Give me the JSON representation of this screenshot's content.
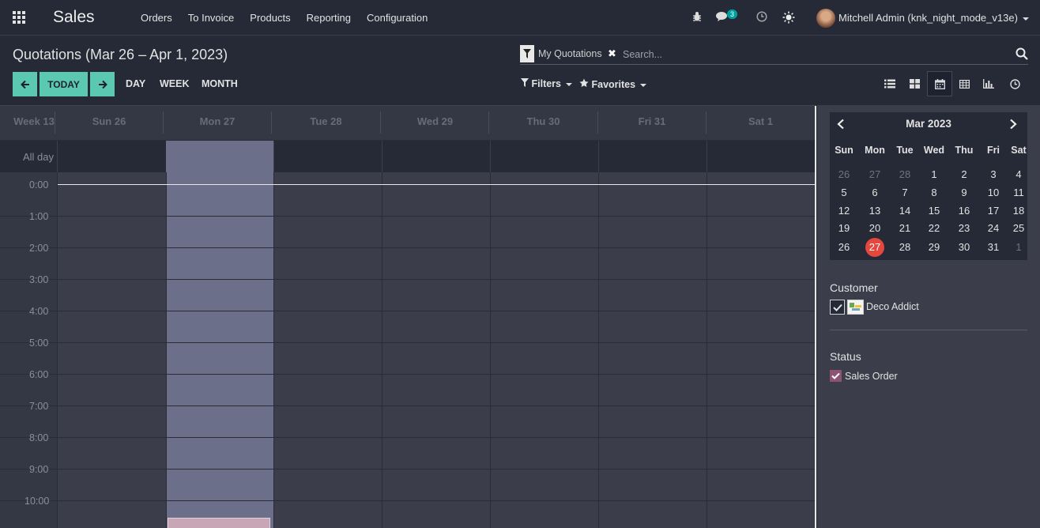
{
  "navbar": {
    "app_name": "Sales",
    "menu": [
      "Orders",
      "To Invoice",
      "Products",
      "Reporting",
      "Configuration"
    ],
    "messages_count": "3",
    "user_name": "Mitchell Admin (knk_night_mode_v13e)"
  },
  "control_panel": {
    "title": "Quotations (Mar 26 – Apr 1, 2023)",
    "today_label": "TODAY",
    "scales": [
      "DAY",
      "WEEK",
      "MONTH"
    ],
    "search": {
      "facet": "My Quotations",
      "placeholder": "Search..."
    },
    "filters_label": "Filters",
    "favorites_label": "Favorites",
    "views": [
      "list-view-icon",
      "kanban-view-icon",
      "calendar-view-icon",
      "pivot-view-icon",
      "graph-view-icon",
      "activity-view-icon"
    ]
  },
  "calendar": {
    "week_label": "Week 13",
    "days": [
      "Sun 26",
      "Mon 27",
      "Tue 28",
      "Wed 29",
      "Thu 30",
      "Fri 31",
      "Sat 1"
    ],
    "today_index": 1,
    "allday_label": "All day",
    "hours": [
      "0:00",
      "1:00",
      "2:00",
      "3:00",
      "4:00",
      "5:00",
      "6:00",
      "7:00",
      "8:00",
      "9:00",
      "10:00"
    ]
  },
  "sidebar": {
    "mini_calendar": {
      "title": "Mar 2023",
      "dow": [
        "Sun",
        "Mon",
        "Tue",
        "Wed",
        "Thu",
        "Fri",
        "Sat"
      ],
      "weeks": [
        [
          "26",
          "27",
          "28",
          "1",
          "2",
          "3",
          "4"
        ],
        [
          "5",
          "6",
          "7",
          "8",
          "9",
          "10",
          "11"
        ],
        [
          "12",
          "13",
          "14",
          "15",
          "16",
          "17",
          "18"
        ],
        [
          "19",
          "20",
          "21",
          "22",
          "23",
          "24",
          "25"
        ],
        [
          "26",
          "27",
          "28",
          "29",
          "30",
          "31",
          "1"
        ]
      ],
      "selected": "27"
    },
    "customer_title": "Customer",
    "customer_name": "Deco Addict",
    "status_title": "Status",
    "status_name": "Sales Order"
  }
}
